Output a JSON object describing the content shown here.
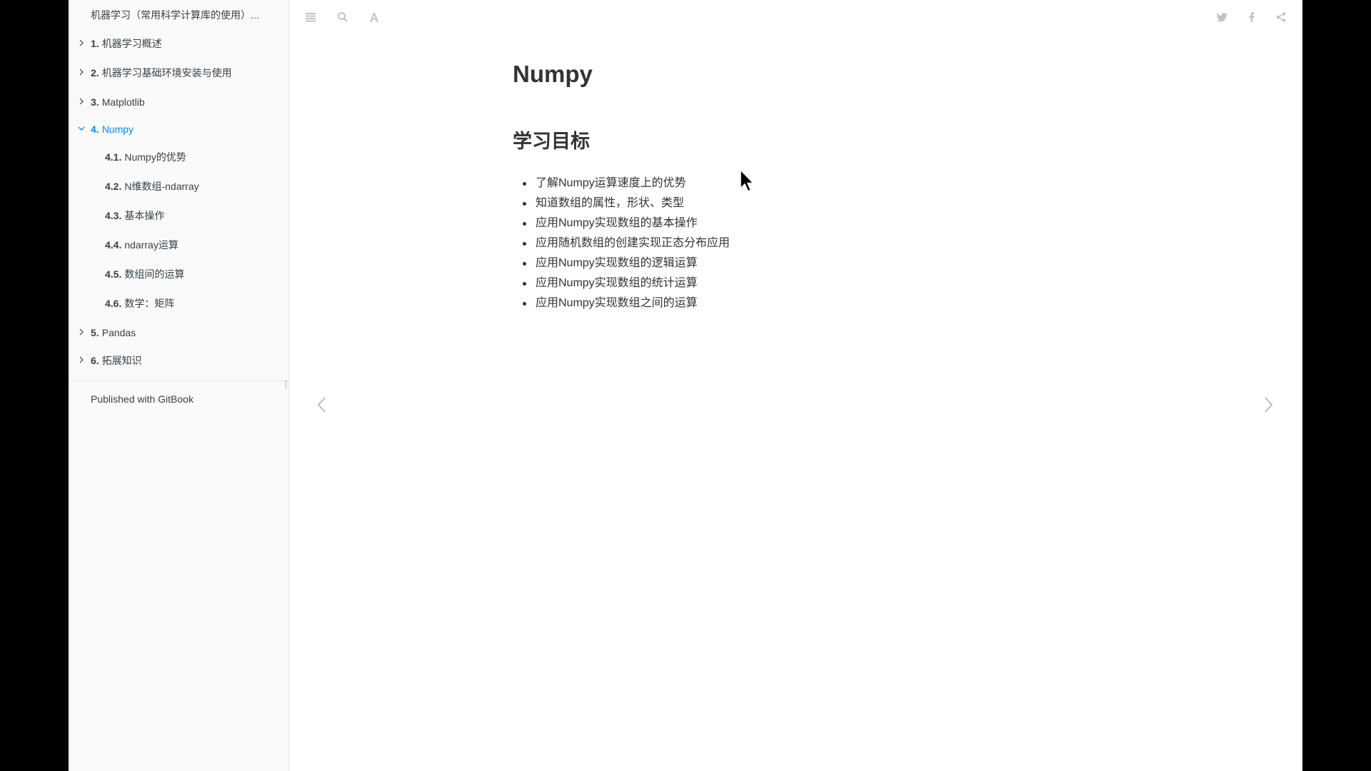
{
  "sidebar": {
    "book_title": "机器学习（常用科学计算库的使用）...",
    "items": [
      {
        "num": "1.",
        "label": "机器学习概述"
      },
      {
        "num": "2.",
        "label": "机器学习基础环境安装与使用"
      },
      {
        "num": "3.",
        "label": "Matplotlib"
      },
      {
        "num": "4.",
        "label": "Numpy"
      },
      {
        "num": "4.1.",
        "label": "Numpy的优势"
      },
      {
        "num": "4.2.",
        "label": "N维数组-ndarray"
      },
      {
        "num": "4.3.",
        "label": "基本操作"
      },
      {
        "num": "4.4.",
        "label": "ndarray运算"
      },
      {
        "num": "4.5.",
        "label": "数组间的运算"
      },
      {
        "num": "4.6.",
        "label": "数学：矩阵"
      },
      {
        "num": "5.",
        "label": "Pandas"
      },
      {
        "num": "6.",
        "label": "拓展知识"
      }
    ],
    "published": "Published with GitBook"
  },
  "toolbar": {
    "left_icons": [
      "menu-icon",
      "search-icon",
      "font-icon"
    ],
    "right_icons": [
      "twitter-icon",
      "facebook-icon",
      "share-icon"
    ]
  },
  "content": {
    "title": "Numpy",
    "section_title": "学习目标",
    "goals": [
      "了解Numpy运算速度上的优势",
      "知道数组的属性，形状、类型",
      "应用Numpy实现数组的基本操作",
      "应用随机数组的创建实现正态分布应用",
      "应用Numpy实现数组的逻辑运算",
      "应用Numpy实现数组的统计运算",
      "应用Numpy实现数组之间的运算"
    ]
  },
  "colors": {
    "active": "#008cff",
    "sidebar_bg": "#fafafa",
    "text": "#333333",
    "icon": "#c2c2c2"
  }
}
